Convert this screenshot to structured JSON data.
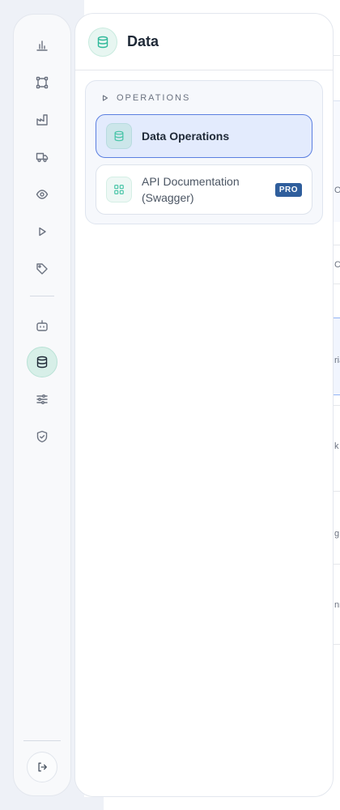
{
  "panel": {
    "title": "Data",
    "icon": "database-icon",
    "accent": "#2fb99a"
  },
  "group": {
    "label": "OPERATIONS",
    "items": [
      {
        "label": "Data Operations",
        "icon": "database-icon",
        "active": true
      },
      {
        "label": "API Documentation (Swagger)",
        "icon": "grid-icon",
        "badge": "PRO",
        "active": false
      }
    ]
  },
  "rail": {
    "items": [
      {
        "icon": "bar-chart-icon"
      },
      {
        "icon": "connections-icon"
      },
      {
        "icon": "factory-icon"
      },
      {
        "icon": "truck-icon"
      },
      {
        "icon": "eye-icon"
      },
      {
        "icon": "play-icon"
      },
      {
        "icon": "tag-icon"
      },
      {
        "icon": "bot-icon"
      },
      {
        "icon": "database-icon",
        "active": true
      },
      {
        "icon": "sliders-icon"
      },
      {
        "icon": "shield-check-icon"
      }
    ],
    "logout_icon": "logout-icon"
  },
  "background": {
    "edge_glyphs": [
      "O",
      "C",
      "ria",
      "k",
      "g",
      "nn"
    ]
  },
  "colors": {
    "active_bg": "#e3ebfd",
    "active_border": "#5b7fe0",
    "badge_bg": "#2f5e9c"
  }
}
